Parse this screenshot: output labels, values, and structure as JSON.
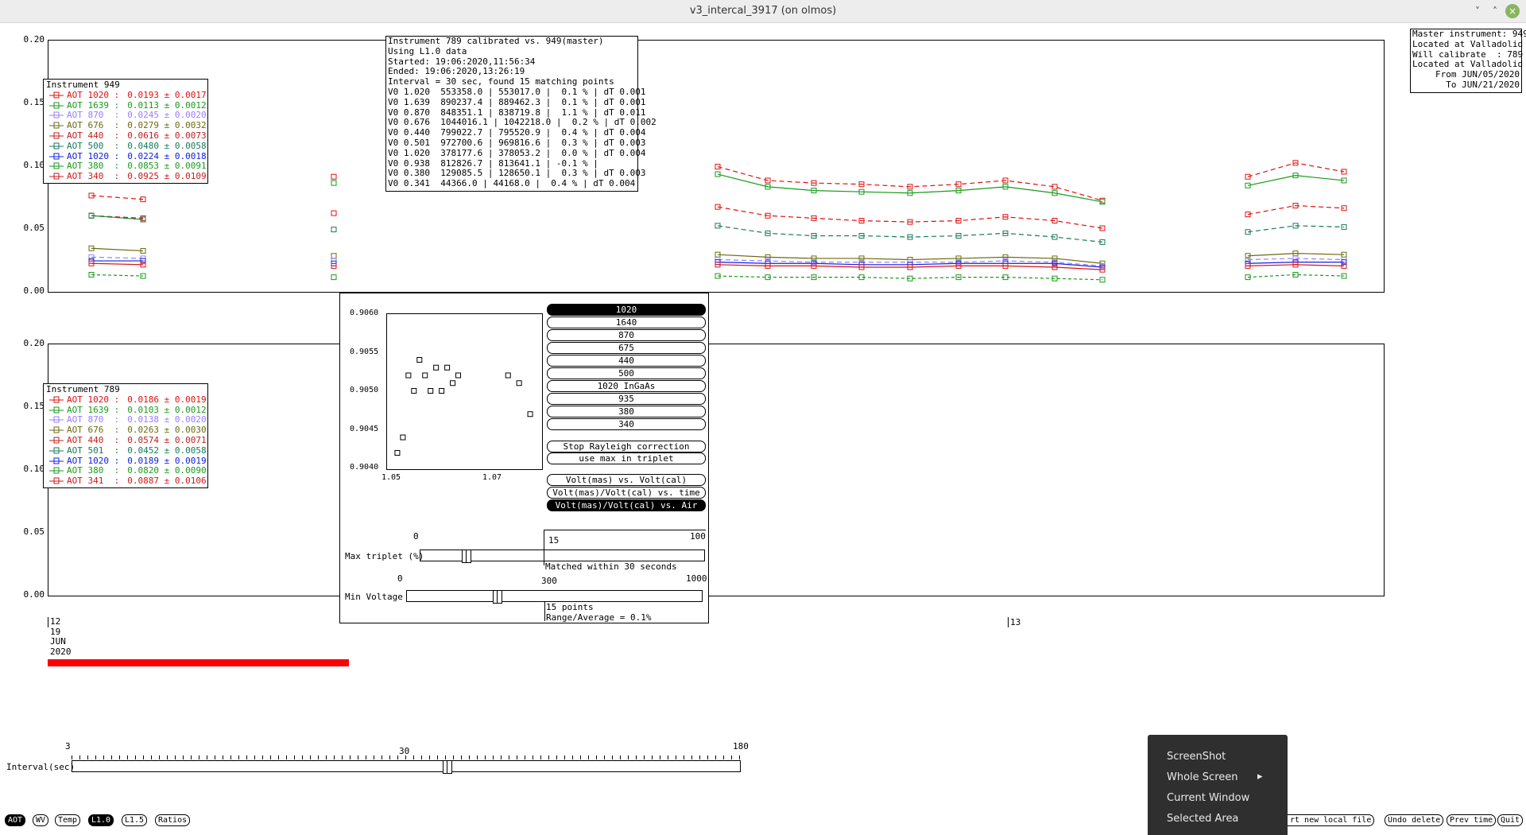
{
  "window": {
    "title": "v3_intercal_3917 (on olmos)",
    "min": "˅",
    "max": "˄",
    "close": "×"
  },
  "plot_top": {
    "yticks": [
      "0.20",
      "0.15",
      "0.10",
      "0.05",
      "0.00"
    ],
    "legend_title": "Instrument 949",
    "legend": [
      {
        "label": "AOT 1020 :",
        "value": "0.0193 ± 0.0017",
        "color": "#e01010"
      },
      {
        "label": "AOT 1639 :",
        "value": "0.0113 ± 0.0012",
        "color": "#1a9a1a"
      },
      {
        "label": "AOT 870  :",
        "value": "0.0245 ± 0.0020",
        "color": "#9a7cff"
      },
      {
        "label": "AOT 676  :",
        "value": "0.0279 ± 0.0032",
        "color": "#6b6b10"
      },
      {
        "label": "AOT 440  :",
        "value": "0.0616 ± 0.0073",
        "color": "#c02020"
      },
      {
        "label": "AOT 500  :",
        "value": "0.0480 ± 0.0058",
        "color": "#157a5a"
      },
      {
        "label": "AOT 1020 :",
        "value": "0.0224 ± 0.0018",
        "color": "#1020e0"
      },
      {
        "label": "AOT 380  :",
        "value": "0.0853 ± 0.0091",
        "color": "#1a9a1a"
      },
      {
        "label": "AOT 340  :",
        "value": "0.0925 ± 0.0109",
        "color": "#d01818"
      }
    ]
  },
  "plot_bottom": {
    "yticks": [
      "0.20",
      "0.15",
      "0.10",
      "0.05",
      "0.00"
    ],
    "legend_title": "Instrument 789",
    "legend": [
      {
        "label": "AOT 1020 :",
        "value": "0.0186 ± 0.0019",
        "color": "#e01010"
      },
      {
        "label": "AOT 1639 :",
        "value": "0.0103 ± 0.0012",
        "color": "#1a9a1a"
      },
      {
        "label": "AOT 870  :",
        "value": "0.0138 ± 0.0020",
        "color": "#9a7cff"
      },
      {
        "label": "AOT 676  :",
        "value": "0.0263 ± 0.0030",
        "color": "#6b6b10"
      },
      {
        "label": "AOT 440  :",
        "value": "0.0574 ± 0.0071",
        "color": "#c02020"
      },
      {
        "label": "AOT 501  :",
        "value": "0.0452 ± 0.0058",
        "color": "#157a5a"
      },
      {
        "label": "AOT 1020 :",
        "value": "0.0189 ± 0.0019",
        "color": "#1020e0"
      },
      {
        "label": "AOT 380  :",
        "value": "0.0820 ± 0.0090",
        "color": "#1a9a1a"
      },
      {
        "label": "AOT 341  :",
        "value": "0.0887 ± 0.0106",
        "color": "#d01818"
      }
    ]
  },
  "calib_info": [
    "Instrument 789 calibrated vs. 949(master)",
    "Using L1.0 data",
    "Started: 19:06:2020,11:56:34",
    "Ended: 19:06:2020,13:26:19",
    "Interval = 30 sec, found 15 matching points",
    "V0 1.020  553358.0 | 553017.0 |  0.1 % | dT 0.001",
    "V0 1.639  890237.4 | 889462.3 |  0.1 % | dT 0.001",
    "V0 0.870  848351.1 | 838719.8 |  1.1 % | dT 0.011",
    "V0 0.676  1044016.1 | 1042218.0 |  0.2 % | dT 0.002",
    "V0 0.440  799022.7 | 795520.9 |  0.4 % | dT 0.004",
    "V0 0.501  972700.6 | 969816.6 |  0.3 % | dT 0.003",
    "V0 1.020  378177.6 | 378053.2 |  0.0 % | dT 0.004",
    "V0 0.938  812826.7 | 813641.1 | -0.1 % |",
    "V0 0.380  129085.5 | 128650.1 |  0.3 % | dT 0.003",
    "V0 0.341  44366.0 | 44168.0 |  0.4 % | dT 0.004"
  ],
  "master_info": [
    "Master instrument: 949",
    "Located at Valladolid",
    "Will calibrate  : 789",
    "Located at Valladolid",
    "From JUN/05/2020",
    "To JUN/21/2020"
  ],
  "xaxis": {
    "d12": [
      "12",
      "19",
      "JUN",
      "2020"
    ],
    "d13": "13"
  },
  "dialog": {
    "scatter": {
      "yticks": [
        "0.9060",
        "0.9055",
        "0.9050",
        "0.9045",
        "0.9040"
      ],
      "xticks": [
        "1.05",
        "1.07"
      ]
    },
    "channels": [
      "1020",
      "1640",
      "870",
      "675",
      "440",
      "500",
      "1020 InGaAs",
      "935",
      "380",
      "340"
    ],
    "selected_channel": "1020",
    "opt_buttons": [
      "Stop Rayleigh correction",
      "use max in triplet"
    ],
    "mode_buttons": [
      "Volt(mas) vs. Volt(cal)",
      "Volt(mas)/Volt(cal) vs. time",
      "Volt(mas)/Volt(cal) vs. Air Mass"
    ],
    "selected_mode": "Volt(mas)/Volt(cal) vs. Air Mass",
    "triplet": {
      "label": "Max triplet (%)",
      "min": "0",
      "max": "100",
      "value": "15",
      "value_num": 15,
      "status": "Matched within 30 seconds"
    },
    "minv": {
      "label": "Min Voltage",
      "min": "0",
      "max": "1000",
      "value": "300",
      "value_num": 300,
      "status1": "15 points",
      "status2": "Range/Average = 0.1%"
    }
  },
  "interval": {
    "label": "Interval(sec)",
    "min": "3",
    "mid": "30",
    "max": "180",
    "value_num": 30
  },
  "bottom_buttons_left": [
    "AOT",
    "WV",
    "Temp",
    "L1.0",
    "L1.5",
    "Ratios"
  ],
  "bottom_buttons_left_selected": [
    "AOT",
    "L1.0"
  ],
  "bottom_buttons_right": [
    "rt new local file",
    "Undo delete",
    "Prev time",
    "Quit"
  ],
  "context_menu": {
    "items": [
      "ScreenShot",
      "Whole Screen",
      "Current Window",
      "Selected Area"
    ],
    "arrow": "▸"
  },
  "colors": {
    "red": "#e01010",
    "green": "#1a9a1a",
    "violet": "#9a7cff",
    "olive": "#6b6b10",
    "teal": "#157a5a",
    "blue": "#1020e0",
    "progress_red": "#ff0000"
  },
  "chart_data": {
    "type": "line",
    "dialog_scatter": {
      "x": [
        1.052,
        1.053,
        1.054,
        1.055,
        1.056,
        1.057,
        1.058,
        1.059,
        1.06,
        1.061,
        1.062,
        1.063,
        1.072,
        1.074,
        1.076
      ],
      "y": [
        0.9042,
        0.9044,
        0.9052,
        0.905,
        0.9054,
        0.9052,
        0.905,
        0.9053,
        0.905,
        0.9053,
        0.9051,
        0.9052,
        0.9052,
        0.9051,
        0.9047
      ],
      "ylim": [
        0.904,
        0.906
      ]
    }
  }
}
